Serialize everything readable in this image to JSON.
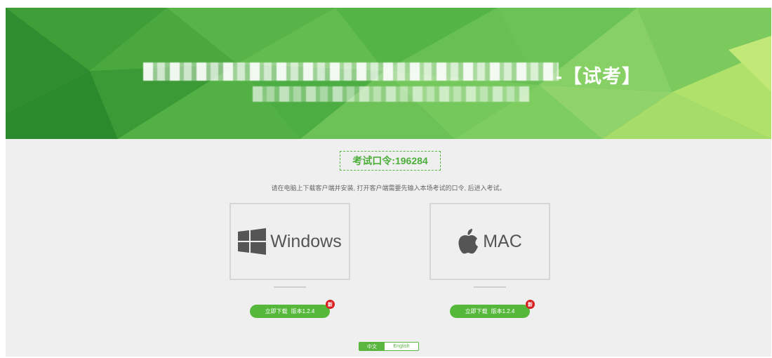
{
  "banner": {
    "title_suffix": "-【试考】",
    "colors": {
      "dark": "#2e8f2e",
      "mid": "#5cb84a",
      "light": "#a8dc63"
    }
  },
  "exam_code": {
    "label": "考试口令:196284"
  },
  "instruction": "请在电脑上下载客户端并安装, 打开客户端需要先输入本场考试的口令, 后进入考试。",
  "downloads": [
    {
      "os": "Windows",
      "icon": "windows-icon",
      "button_label": "立即下载",
      "version": "版本1.2.4",
      "badge": "新"
    },
    {
      "os": "MAC",
      "icon": "apple-icon",
      "button_label": "立即下载",
      "version": "版本1.2.4",
      "badge": "新"
    }
  ],
  "language": {
    "options": [
      "中文",
      "English"
    ],
    "selected": "中文"
  },
  "accent_color": "#56b83b",
  "badge_color": "#d81e1e"
}
